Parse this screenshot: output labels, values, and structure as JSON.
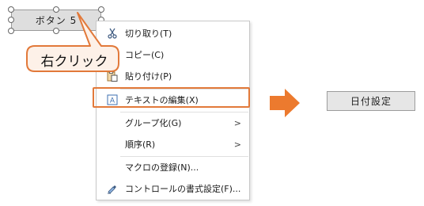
{
  "form_button": {
    "label": "ボタン 5"
  },
  "callout": {
    "text": "右クリック"
  },
  "context_menu": {
    "items": [
      {
        "label": "切り取り(T)",
        "icon": "scissors-icon"
      },
      {
        "label": "コピー(C)",
        "icon": "copy-icon"
      },
      {
        "label": "貼り付け(P)",
        "icon": "paste-icon"
      },
      {
        "label": "テキストの編集(X)",
        "icon": "edit-text-icon"
      },
      {
        "label": "グループ化(G)",
        "submenu_indicator": ">"
      },
      {
        "label": "順序(R)",
        "submenu_indicator": ">"
      },
      {
        "label": "マクロの登録(N)..."
      },
      {
        "label": "コントロールの書式設定(F)...",
        "icon": "format-control-icon"
      }
    ]
  },
  "result_button": {
    "label": "日付設定"
  },
  "colors": {
    "accent": "#e2793a",
    "callout_fill": "#fdf1e8"
  }
}
